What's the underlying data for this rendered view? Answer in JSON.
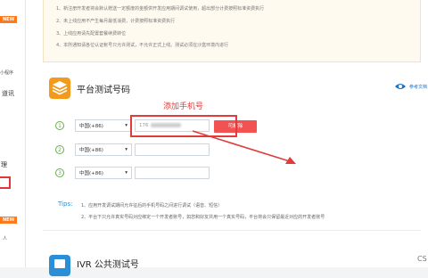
{
  "sidebar": {
    "badges": [
      "NEW",
      "NEW"
    ],
    "items": [
      "小程序",
      "道讯",
      "理",
      "人"
    ]
  },
  "notice": {
    "lines": [
      "1、新注册开发者将会默认赠送一定额度的金额供开发应用期间调试使用，超出部分计费按照标准资费执行",
      "2、未上线应用不产生每月最低消费，计费按照标准资费执行",
      "3、上线应用请先配置套餐续费转位",
      "4、本所通知请各位认证帐号只允许测试，不允许正式上线。测试必须在沙盒环境内进行"
    ]
  },
  "platform": {
    "title": "平台测试号码",
    "help_label": "参考文档"
  },
  "rows": [
    {
      "num": "1",
      "country": "中国(+86)",
      "phone_prefix": "176"
    },
    {
      "num": "2",
      "country": "中国(+86)",
      "phone_prefix": ""
    },
    {
      "num": "3",
      "country": "中国(+86)",
      "phone_prefix": ""
    }
  ],
  "confirm_button": "可解除",
  "annotation": "添加手机号",
  "tips": {
    "label": "Tips:",
    "lines": [
      "1、应用开发调试期间允许征后的手机号码之间进行调试（语音、短信）",
      "2、平台下只允许真实号码对应绑定一个开发者账号，如您和好友共用一个真实号码，平台将会只保留最近对应的开发者账号"
    ]
  },
  "ivr": {
    "title": "IVR 公共测试号"
  },
  "corner_text": "CS",
  "colors": {
    "accent": "#e23b3b",
    "link": "#1a73c8",
    "green": "#63b04a",
    "orange": "#ff7a1a"
  }
}
